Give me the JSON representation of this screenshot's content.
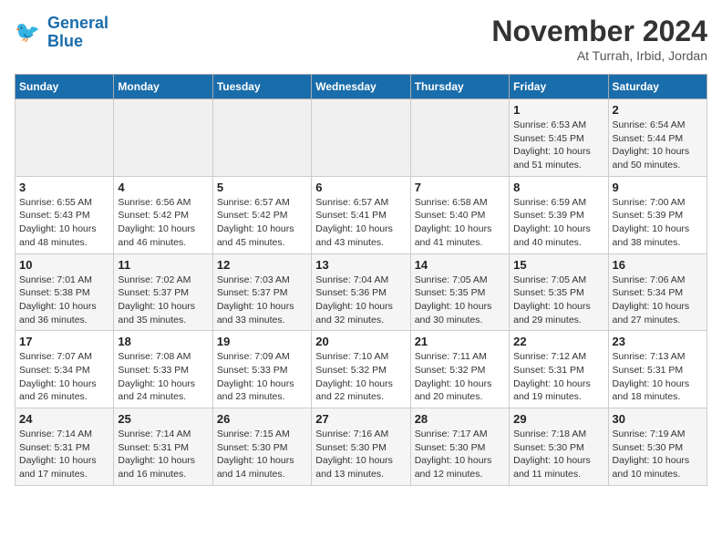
{
  "header": {
    "logo_line1": "General",
    "logo_line2": "Blue",
    "month": "November 2024",
    "location": "At Turrah, Irbid, Jordan"
  },
  "weekdays": [
    "Sunday",
    "Monday",
    "Tuesday",
    "Wednesday",
    "Thursday",
    "Friday",
    "Saturday"
  ],
  "weeks": [
    [
      {
        "day": "",
        "sunrise": "",
        "sunset": "",
        "daylight": ""
      },
      {
        "day": "",
        "sunrise": "",
        "sunset": "",
        "daylight": ""
      },
      {
        "day": "",
        "sunrise": "",
        "sunset": "",
        "daylight": ""
      },
      {
        "day": "",
        "sunrise": "",
        "sunset": "",
        "daylight": ""
      },
      {
        "day": "",
        "sunrise": "",
        "sunset": "",
        "daylight": ""
      },
      {
        "day": "1",
        "sunrise": "Sunrise: 6:53 AM",
        "sunset": "Sunset: 5:45 PM",
        "daylight": "Daylight: 10 hours and 51 minutes."
      },
      {
        "day": "2",
        "sunrise": "Sunrise: 6:54 AM",
        "sunset": "Sunset: 5:44 PM",
        "daylight": "Daylight: 10 hours and 50 minutes."
      }
    ],
    [
      {
        "day": "3",
        "sunrise": "Sunrise: 6:55 AM",
        "sunset": "Sunset: 5:43 PM",
        "daylight": "Daylight: 10 hours and 48 minutes."
      },
      {
        "day": "4",
        "sunrise": "Sunrise: 6:56 AM",
        "sunset": "Sunset: 5:42 PM",
        "daylight": "Daylight: 10 hours and 46 minutes."
      },
      {
        "day": "5",
        "sunrise": "Sunrise: 6:57 AM",
        "sunset": "Sunset: 5:42 PM",
        "daylight": "Daylight: 10 hours and 45 minutes."
      },
      {
        "day": "6",
        "sunrise": "Sunrise: 6:57 AM",
        "sunset": "Sunset: 5:41 PM",
        "daylight": "Daylight: 10 hours and 43 minutes."
      },
      {
        "day": "7",
        "sunrise": "Sunrise: 6:58 AM",
        "sunset": "Sunset: 5:40 PM",
        "daylight": "Daylight: 10 hours and 41 minutes."
      },
      {
        "day": "8",
        "sunrise": "Sunrise: 6:59 AM",
        "sunset": "Sunset: 5:39 PM",
        "daylight": "Daylight: 10 hours and 40 minutes."
      },
      {
        "day": "9",
        "sunrise": "Sunrise: 7:00 AM",
        "sunset": "Sunset: 5:39 PM",
        "daylight": "Daylight: 10 hours and 38 minutes."
      }
    ],
    [
      {
        "day": "10",
        "sunrise": "Sunrise: 7:01 AM",
        "sunset": "Sunset: 5:38 PM",
        "daylight": "Daylight: 10 hours and 36 minutes."
      },
      {
        "day": "11",
        "sunrise": "Sunrise: 7:02 AM",
        "sunset": "Sunset: 5:37 PM",
        "daylight": "Daylight: 10 hours and 35 minutes."
      },
      {
        "day": "12",
        "sunrise": "Sunrise: 7:03 AM",
        "sunset": "Sunset: 5:37 PM",
        "daylight": "Daylight: 10 hours and 33 minutes."
      },
      {
        "day": "13",
        "sunrise": "Sunrise: 7:04 AM",
        "sunset": "Sunset: 5:36 PM",
        "daylight": "Daylight: 10 hours and 32 minutes."
      },
      {
        "day": "14",
        "sunrise": "Sunrise: 7:05 AM",
        "sunset": "Sunset: 5:35 PM",
        "daylight": "Daylight: 10 hours and 30 minutes."
      },
      {
        "day": "15",
        "sunrise": "Sunrise: 7:05 AM",
        "sunset": "Sunset: 5:35 PM",
        "daylight": "Daylight: 10 hours and 29 minutes."
      },
      {
        "day": "16",
        "sunrise": "Sunrise: 7:06 AM",
        "sunset": "Sunset: 5:34 PM",
        "daylight": "Daylight: 10 hours and 27 minutes."
      }
    ],
    [
      {
        "day": "17",
        "sunrise": "Sunrise: 7:07 AM",
        "sunset": "Sunset: 5:34 PM",
        "daylight": "Daylight: 10 hours and 26 minutes."
      },
      {
        "day": "18",
        "sunrise": "Sunrise: 7:08 AM",
        "sunset": "Sunset: 5:33 PM",
        "daylight": "Daylight: 10 hours and 24 minutes."
      },
      {
        "day": "19",
        "sunrise": "Sunrise: 7:09 AM",
        "sunset": "Sunset: 5:33 PM",
        "daylight": "Daylight: 10 hours and 23 minutes."
      },
      {
        "day": "20",
        "sunrise": "Sunrise: 7:10 AM",
        "sunset": "Sunset: 5:32 PM",
        "daylight": "Daylight: 10 hours and 22 minutes."
      },
      {
        "day": "21",
        "sunrise": "Sunrise: 7:11 AM",
        "sunset": "Sunset: 5:32 PM",
        "daylight": "Daylight: 10 hours and 20 minutes."
      },
      {
        "day": "22",
        "sunrise": "Sunrise: 7:12 AM",
        "sunset": "Sunset: 5:31 PM",
        "daylight": "Daylight: 10 hours and 19 minutes."
      },
      {
        "day": "23",
        "sunrise": "Sunrise: 7:13 AM",
        "sunset": "Sunset: 5:31 PM",
        "daylight": "Daylight: 10 hours and 18 minutes."
      }
    ],
    [
      {
        "day": "24",
        "sunrise": "Sunrise: 7:14 AM",
        "sunset": "Sunset: 5:31 PM",
        "daylight": "Daylight: 10 hours and 17 minutes."
      },
      {
        "day": "25",
        "sunrise": "Sunrise: 7:14 AM",
        "sunset": "Sunset: 5:31 PM",
        "daylight": "Daylight: 10 hours and 16 minutes."
      },
      {
        "day": "26",
        "sunrise": "Sunrise: 7:15 AM",
        "sunset": "Sunset: 5:30 PM",
        "daylight": "Daylight: 10 hours and 14 minutes."
      },
      {
        "day": "27",
        "sunrise": "Sunrise: 7:16 AM",
        "sunset": "Sunset: 5:30 PM",
        "daylight": "Daylight: 10 hours and 13 minutes."
      },
      {
        "day": "28",
        "sunrise": "Sunrise: 7:17 AM",
        "sunset": "Sunset: 5:30 PM",
        "daylight": "Daylight: 10 hours and 12 minutes."
      },
      {
        "day": "29",
        "sunrise": "Sunrise: 7:18 AM",
        "sunset": "Sunset: 5:30 PM",
        "daylight": "Daylight: 10 hours and 11 minutes."
      },
      {
        "day": "30",
        "sunrise": "Sunrise: 7:19 AM",
        "sunset": "Sunset: 5:30 PM",
        "daylight": "Daylight: 10 hours and 10 minutes."
      }
    ]
  ]
}
